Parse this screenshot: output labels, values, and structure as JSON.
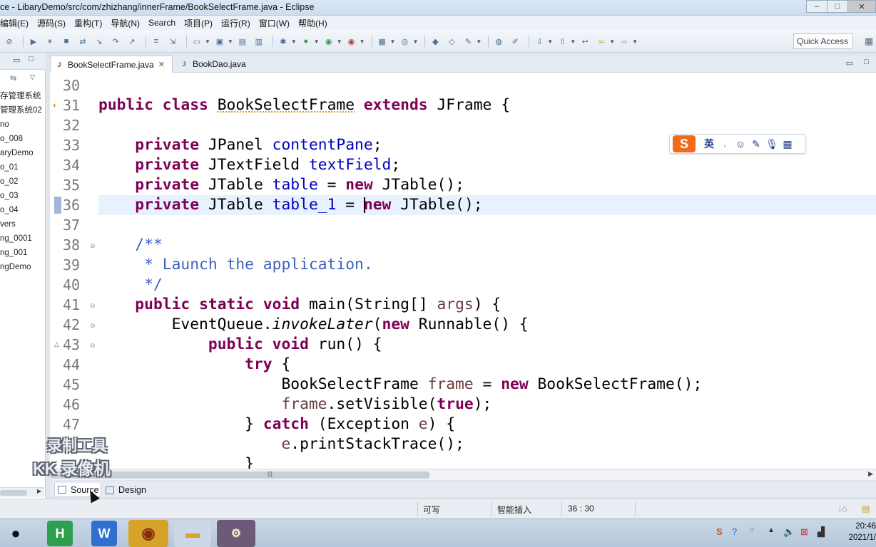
{
  "window": {
    "title": "ce - LibaryDemo/src/com/zhizhang/innerFrame/BookSelectFrame.java - Eclipse"
  },
  "menu": [
    "编辑(E)",
    "源码(S)",
    "重构(T)",
    "导航(N)",
    "Search",
    "项目(P)",
    "运行(R)",
    "窗口(W)",
    "帮助(H)"
  ],
  "toolbar": {
    "quick_access": "Quick Access"
  },
  "left_panel": {
    "items": [
      "存管理系统",
      "管理系统02",
      "no",
      "o_008",
      "aryDemo",
      "o_01",
      "o_02",
      "o_03",
      "o_04",
      "vers",
      "ng_0001",
      "ng_001",
      "ngDemo"
    ]
  },
  "editor_tabs": [
    {
      "label": "BookSelectFrame.java",
      "active": true
    },
    {
      "label": "BookDao.java",
      "active": false
    }
  ],
  "ime": {
    "mode": "英",
    "brand_letter": "S"
  },
  "code": {
    "l30": {
      "n": "30"
    },
    "l31": {
      "n": "31",
      "kw1": "public",
      "kw2": "class",
      "t1": "BookSelectFrame",
      "kw3": "extends",
      "t2": "JFrame {"
    },
    "l32": {
      "n": "32"
    },
    "l33": {
      "n": "33",
      "kw1": "private",
      "t1": "JPanel",
      "f1": "contentPane",
      "t2": ";"
    },
    "l34": {
      "n": "34",
      "kw1": "private",
      "t1": "JTextField",
      "f1": "textField",
      "t2": ";"
    },
    "l35": {
      "n": "35",
      "kw1": "private",
      "t1": "JTable",
      "f1": "table",
      "t2": "=",
      "kw2": "new",
      "t3": "JTable();"
    },
    "l36": {
      "n": "36",
      "kw1": "private",
      "t1": "JTable",
      "f1": "table_1",
      "t2": "=",
      "kw2": "new",
      "t3": "JTable();"
    },
    "l37": {
      "n": "37"
    },
    "l38": {
      "n": "38",
      "c": "/**"
    },
    "l39": {
      "n": "39",
      "c": " * Launch the application."
    },
    "l40": {
      "n": "40",
      "c": " */"
    },
    "l41": {
      "n": "41",
      "kw1": "public",
      "kw2": "static",
      "kw3": "void",
      "t1": "main(String[]",
      "p1": "args",
      "t2": ") {"
    },
    "l42": {
      "n": "42",
      "t1": "EventQueue.",
      "m1": "invokeLater",
      "t2": "(",
      "kw1": "new",
      "t3": "Runnable() {"
    },
    "l43": {
      "n": "43",
      "kw1": "public",
      "kw2": "void",
      "t1": "run() {"
    },
    "l44": {
      "n": "44",
      "kw1": "try",
      "t1": "{"
    },
    "l45": {
      "n": "45",
      "t1": "BookSelectFrame",
      "v1": "frame",
      "t2": "=",
      "kw1": "new",
      "t3": "BookSelectFrame();"
    },
    "l46": {
      "n": "46",
      "v1": "frame",
      "t1": ".setVisible(",
      "kw1": "true",
      "t2": ");"
    },
    "l47": {
      "n": "47",
      "t1": "}",
      "kw1": "catch",
      "t2": "(Exception",
      "v1": "e",
      "t3": ") {"
    },
    "l48": {
      "v1": "e",
      "t1": ".printStackTrace();"
    },
    "l49": {
      "t1": "}"
    }
  },
  "bottom_tabs": {
    "source": "Source",
    "design": "Design"
  },
  "status": {
    "writable": "可写",
    "insert_mode": "智能插入",
    "position": "36 : 30"
  },
  "watermark": {
    "line1": "录制工具",
    "line2": "KK 录像机"
  },
  "clock": {
    "time": "20:46",
    "date": "2021/1/"
  }
}
